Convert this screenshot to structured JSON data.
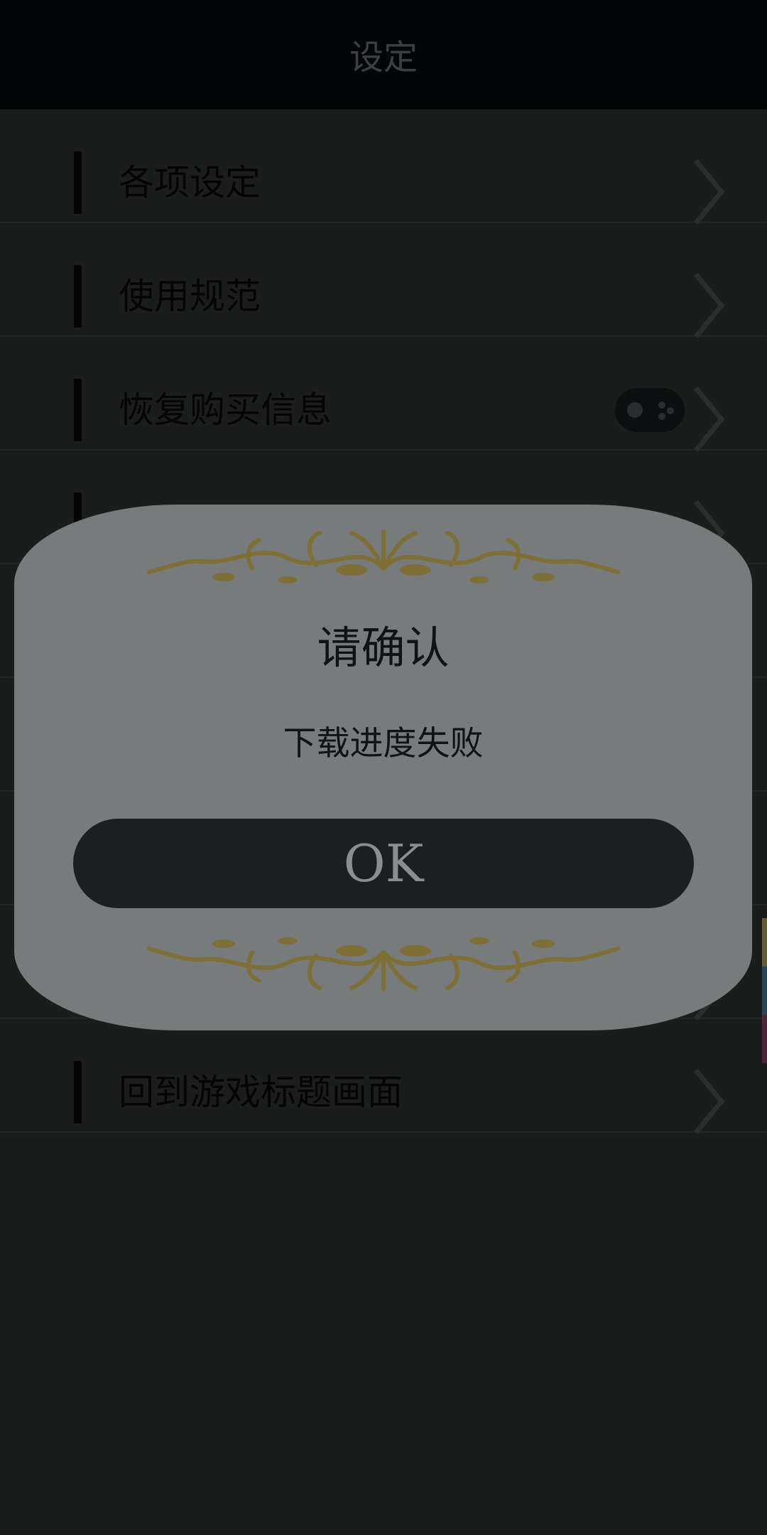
{
  "header": {
    "title": "设定"
  },
  "list": {
    "items": [
      {
        "label": "各项设定"
      },
      {
        "label": "使用规范"
      },
      {
        "label": "恢复购买信息"
      },
      {
        "label": ""
      },
      {
        "label": ""
      },
      {
        "label": ""
      },
      {
        "label": ""
      },
      {
        "label": ""
      },
      {
        "label": "回到游戏标题画面"
      }
    ]
  },
  "dialog": {
    "title": "请确认",
    "message": "下载进度失败",
    "ok_label": "OK"
  },
  "colors": {
    "header_bg": "#040507",
    "page_bg": "#1b1c1c",
    "dialog_bg": "#777b7c",
    "ornament_gold": "#7e6f36",
    "button_bg": "#1d1e22"
  }
}
